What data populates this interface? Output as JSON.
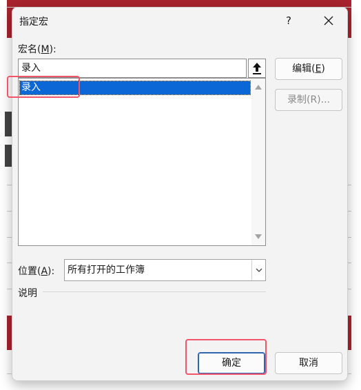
{
  "dialog": {
    "title": "指定宏",
    "help_label": "?",
    "close_icon": "close-icon"
  },
  "macro_name": {
    "label_prefix": "宏名(",
    "label_hotkey": "M",
    "label_suffix": "):",
    "value": "录入"
  },
  "macro_list": {
    "items": [
      "录入"
    ],
    "selected_index": 0
  },
  "buttons": {
    "edit_prefix": "编辑(",
    "edit_hotkey": "E",
    "edit_suffix": ")",
    "record": "录制(R)...",
    "ok": "确定",
    "cancel": "取消"
  },
  "location": {
    "label_prefix": "位置(",
    "label_hotkey": "A",
    "label_suffix": "):",
    "value": "所有打开的工作簿"
  },
  "description": {
    "label": "说明"
  },
  "colors": {
    "selection": "#0b66d6",
    "annotation": "#f2546a",
    "background_band": "#a8232d"
  }
}
